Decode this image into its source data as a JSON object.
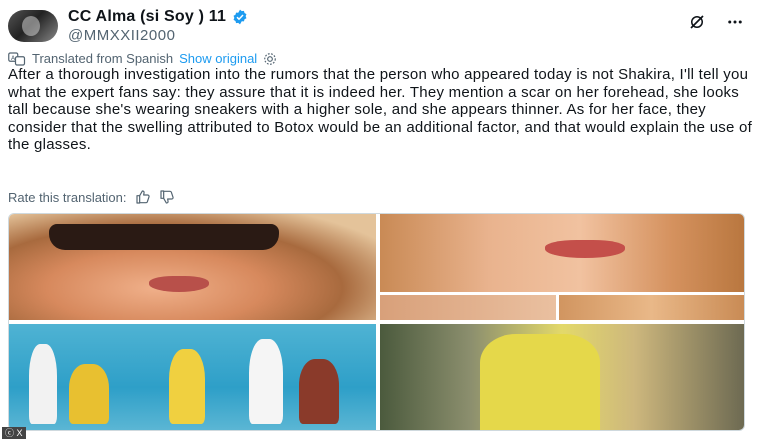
{
  "author": {
    "display_name": "CC Alma (si Soy ) 11",
    "handle": "@MMXXII2000"
  },
  "translation": {
    "translated_label": "Translated from Spanish",
    "show_original": "Show original",
    "rate_label": "Rate this translation:"
  },
  "tweet_text": "After a thorough investigation into the rumors that the person who appeared today is not Shakira, I'll tell you what the expert fans say: they assure that it is indeed her. They mention a scar on her forehead, she looks tall because she's wearing sneakers with a higher sole, and she appears thinner. As for her face, they consider that the swelling attributed to Botox would be an additional factor, and that would explain the use of the glasses.",
  "icons": {
    "verified": "verified-badge-icon",
    "grok": "grok-icon",
    "more": "more-icon",
    "translate": "translate-icon",
    "settings": "gear-icon",
    "like": "thumbs-up-icon",
    "dislike": "thumbs-down-icon"
  },
  "colors": {
    "accent": "#1d9bf0",
    "text": "#0f1419",
    "muted": "#536471"
  },
  "watermark": "ⓒ X"
}
